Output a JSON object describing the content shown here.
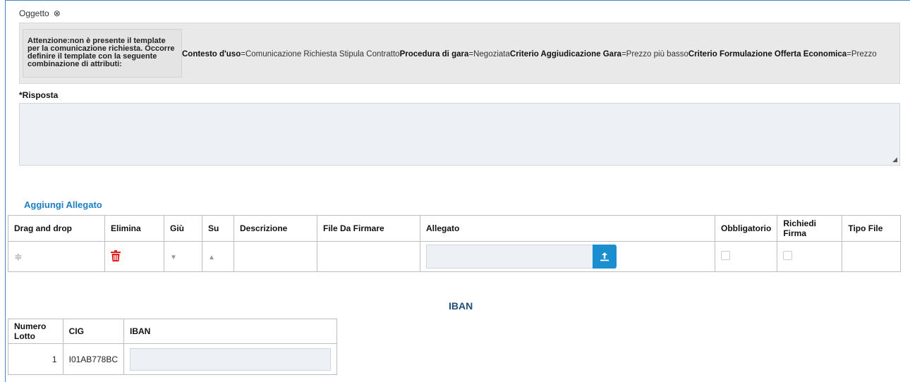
{
  "oggetto": {
    "label": "Oggetto",
    "icon": "close-circle-icon"
  },
  "warning": {
    "text": "Attenzione:non è presente il template per la comunicazione richiesta. Occorre definire il template con la seguente combinazione di attributi:"
  },
  "attributes": [
    {
      "key": "Contesto d'uso",
      "value": "Comunicazione Richiesta Stipula Contratto"
    },
    {
      "key": "Procedura di gara",
      "value": "Negoziata"
    },
    {
      "key": "Criterio Aggiudicazione Gara",
      "value": "Prezzo più basso"
    },
    {
      "key": "Criterio Formulazione Offerta Economica",
      "value": "Prezzo"
    }
  ],
  "risposta": {
    "label": "*Risposta",
    "value": ""
  },
  "attachments": {
    "add_label": "Aggiungi Allegato",
    "headers": [
      "Drag and drop",
      "Elimina",
      "Giù",
      "Su",
      "Descrizione",
      "File Da Firmare",
      "Allegato",
      "Obbligatorio",
      "Richiedi Firma",
      "Tipo File"
    ],
    "rows": [
      {
        "descrizione": "",
        "file_da_firmare": "",
        "allegato": "",
        "obbligatorio": false,
        "richiedi_firma": false,
        "tipo_file": ""
      }
    ],
    "delete_color": "#e02020",
    "upload_color": "#1a8fd0"
  },
  "iban": {
    "title": "IBAN",
    "headers": [
      "Numero Lotto",
      "CIG",
      "IBAN"
    ],
    "rows": [
      {
        "lotto": "1",
        "cig": "I01AB778BC",
        "iban": ""
      }
    ]
  }
}
